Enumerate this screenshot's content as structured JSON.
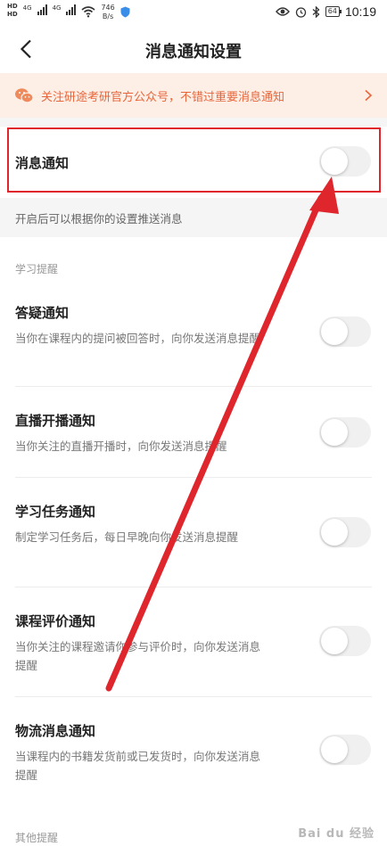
{
  "status_bar": {
    "hd1": "HD",
    "hd2": "HD",
    "net1": "4G",
    "net2": "4G",
    "speed_value": "746",
    "speed_unit": "B/s",
    "battery": "64",
    "time": "10:19"
  },
  "header": {
    "title": "消息通知设置"
  },
  "banner": {
    "text": "关注研途考研官方公众号，不错过重要消息通知"
  },
  "master": {
    "title": "消息通知",
    "description": "开启后可以根据你的设置推送消息"
  },
  "sections": {
    "study_label": "学习提醒",
    "other_label": "其他提醒"
  },
  "items": [
    {
      "title": "答疑通知",
      "desc": "当你在课程内的提问被回答时，向你发送消息提醒"
    },
    {
      "title": "直播开播通知",
      "desc": "当你关注的直播开播时，向你发送消息提醒"
    },
    {
      "title": "学习任务通知",
      "desc": "制定学习任务后，每日早晚向你发送消息提醒"
    },
    {
      "title": "课程评价通知",
      "desc": "当你关注的课程邀请你参与评价时，向你发送消息提醒"
    },
    {
      "title": "物流消息通知",
      "desc": "当课程内的书籍发货前或已发货时，向你发送消息提醒"
    }
  ],
  "watermark": "Bai du 经验",
  "colors": {
    "accent": "#e8663a",
    "banner_bg": "#fdeee6",
    "annotation_red": "#e0262d",
    "toggle_off": "#f0f0f0"
  }
}
